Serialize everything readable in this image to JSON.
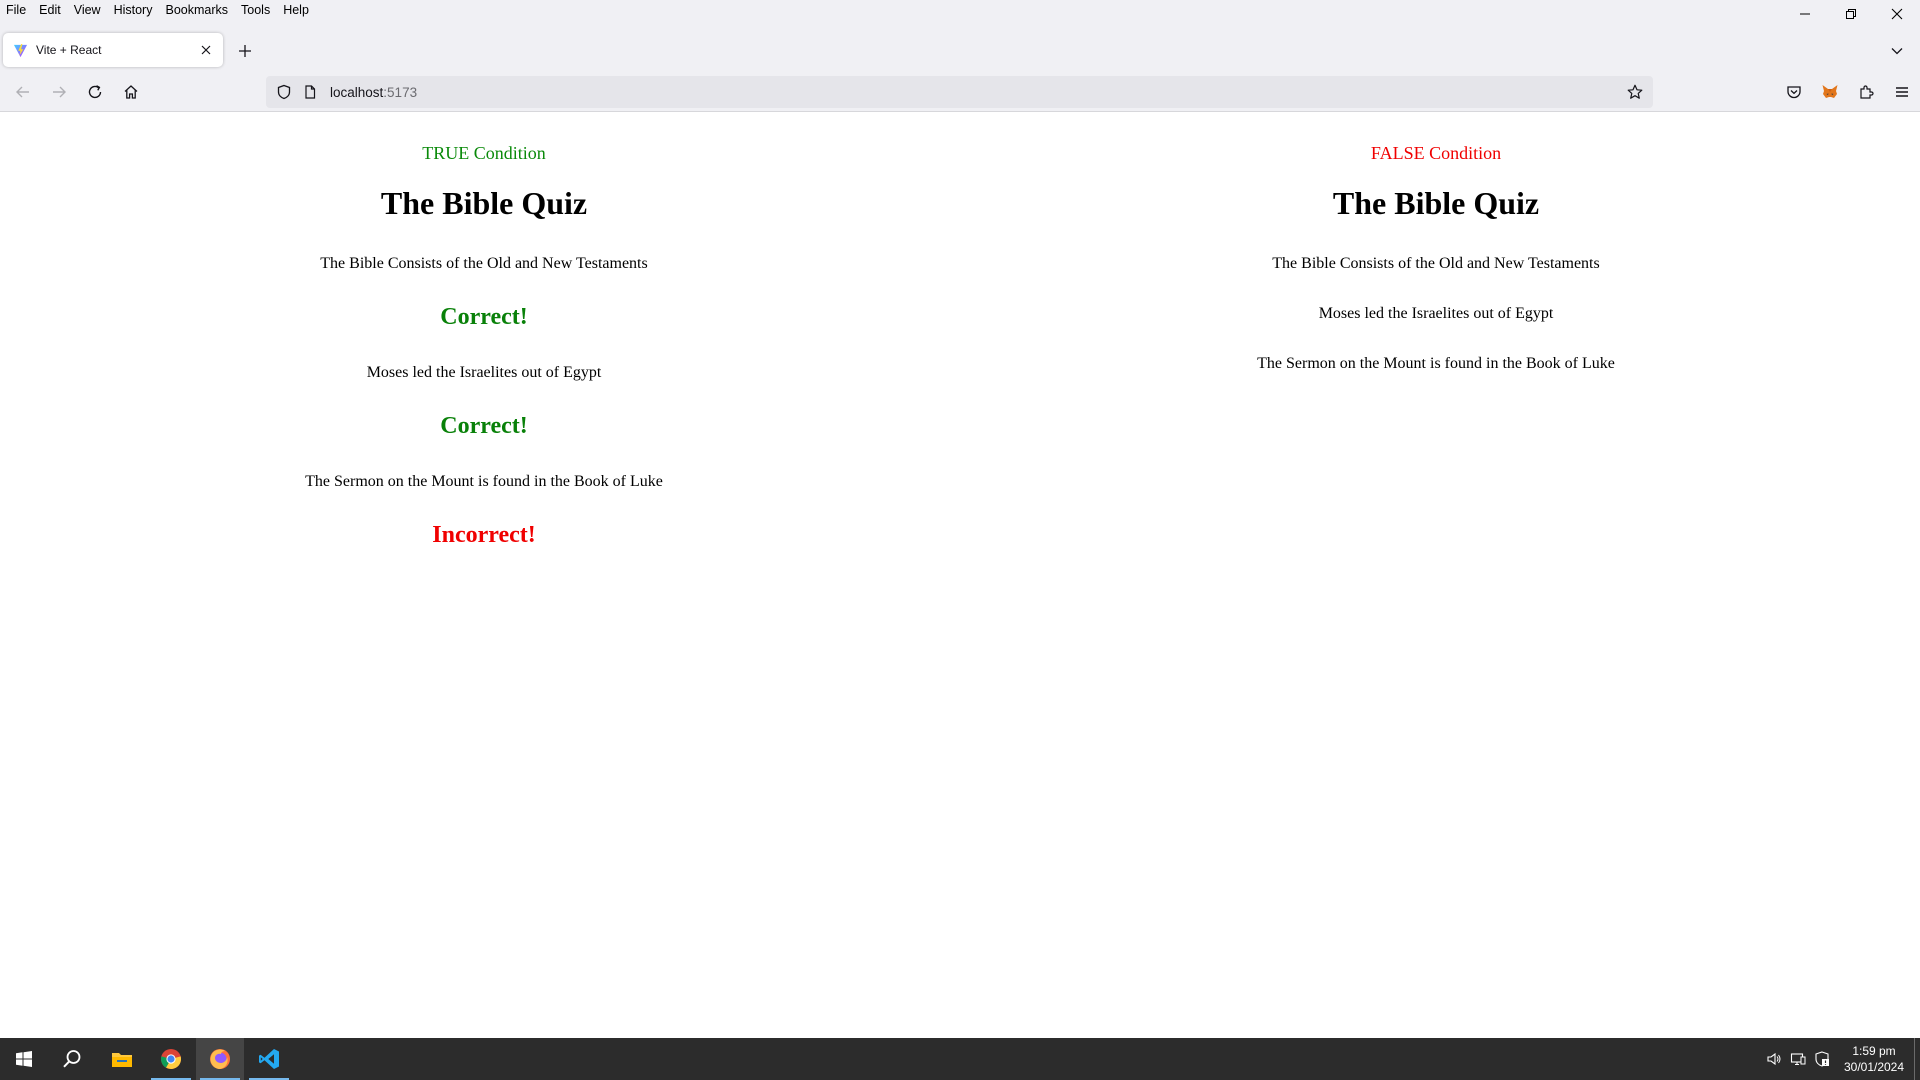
{
  "menubar": {
    "items": [
      "File",
      "Edit",
      "View",
      "History",
      "Bookmarks",
      "Tools",
      "Help"
    ]
  },
  "tab": {
    "title": "Vite + React"
  },
  "urlbar": {
    "host": "localhost",
    "port": ":5173"
  },
  "left": {
    "condition": "TRUE Condition",
    "condition_color": "#0a8a0a",
    "title": "The Bible Quiz",
    "items": [
      {
        "question": "The Bible Consists of the Old and New Testaments",
        "verdict": "Correct!",
        "verdict_color": "#098109"
      },
      {
        "question": "Moses led the Israelites out of Egypt",
        "verdict": "Correct!",
        "verdict_color": "#098109"
      },
      {
        "question": "The Sermon on the Mount is found in the Book of Luke",
        "verdict": "Incorrect!",
        "verdict_color": "#f00000"
      }
    ]
  },
  "right": {
    "condition": "FALSE Condition",
    "condition_color": "#f00000",
    "title": "The Bible Quiz",
    "questions": [
      "The Bible Consists of the Old and New Testaments",
      "Moses led the Israelites out of Egypt",
      "The Sermon on the Mount is found in the Book of Luke"
    ]
  },
  "taskbar": {
    "time": "1:59 pm",
    "date": "30/01/2024"
  }
}
